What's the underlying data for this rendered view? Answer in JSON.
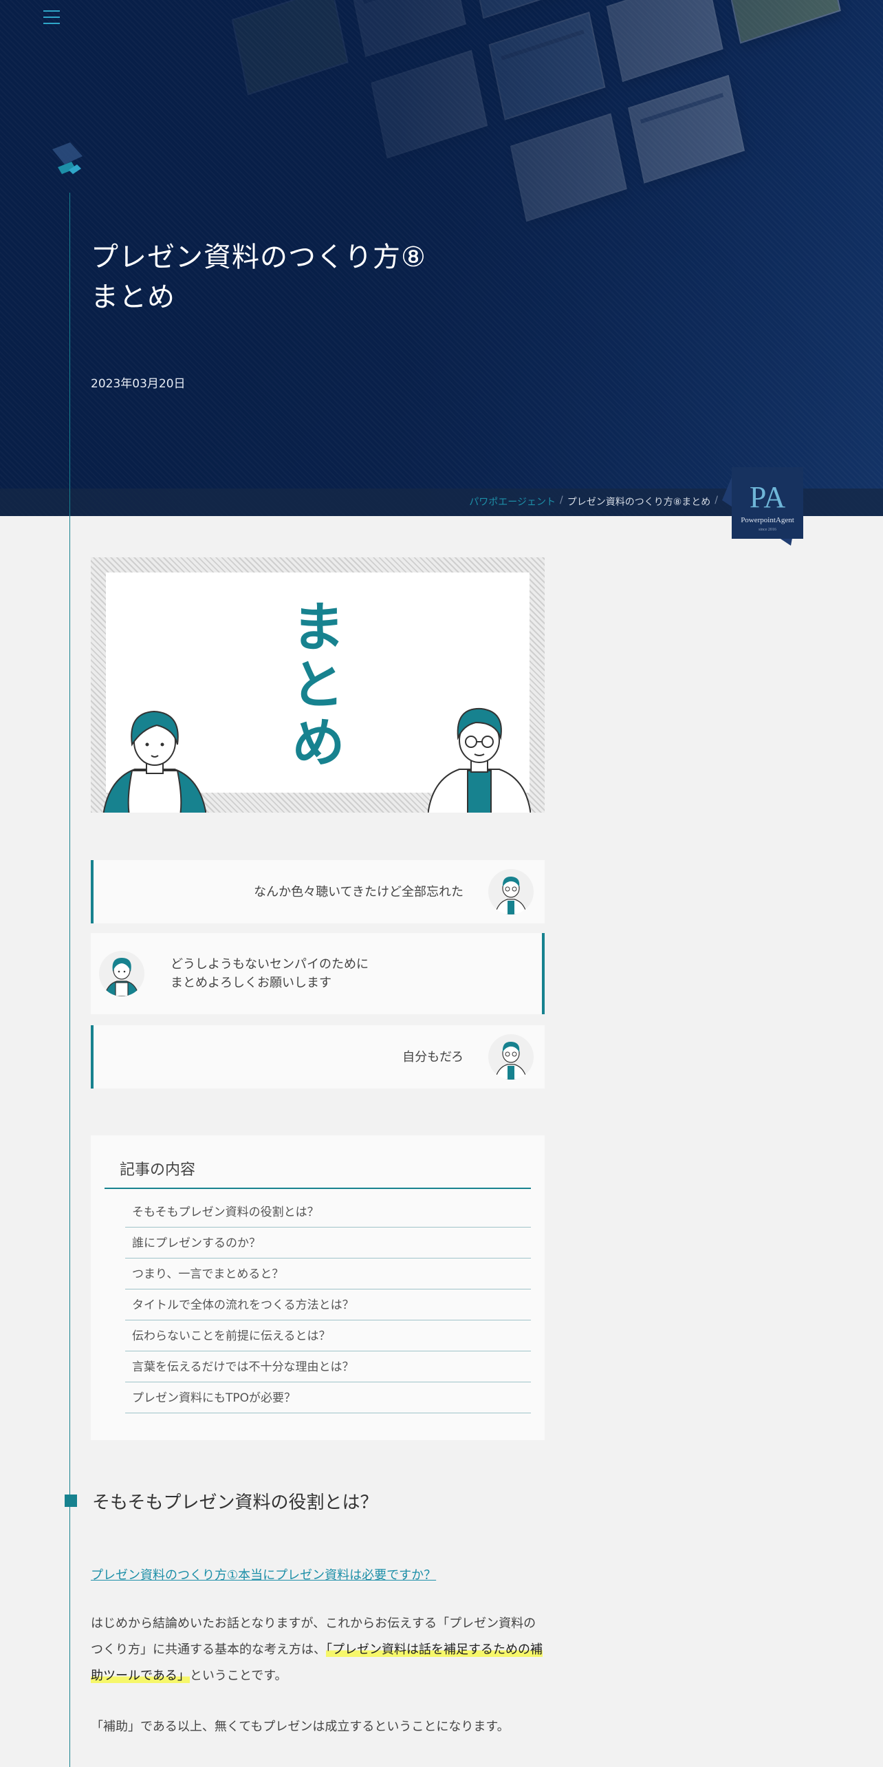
{
  "hero": {
    "title_line1": "プレゼン資料のつくり方⑧",
    "title_line2": "まとめ",
    "date": "2023年03月20日"
  },
  "breadcrumb": {
    "home": "パワポエージェント",
    "separator": "/",
    "current": "プレゼン資料のつくり方⑧まとめ"
  },
  "badge": {
    "logo_text": "PA",
    "name": "PowerpointAgent",
    "since": "since 2016"
  },
  "eyecatch": {
    "word": "まとめ"
  },
  "chat": [
    {
      "text": "なんか色々聴いてきたけど全部忘れた"
    },
    {
      "line1": "どうしようもないセンパイのために",
      "line2": "まとめよろしくお願いします"
    },
    {
      "text": "自分もだろ"
    }
  ],
  "toc": {
    "title": "記事の内容",
    "items": [
      "そもそもプレゼン資料の役割とは？",
      "誰にプレゼンするのか？",
      "つまり、一言でまとめると？",
      "タイトルで全体の流れをつくる方法とは？",
      "伝わらないことを前提に伝えるとは？",
      "言葉を伝えるだけでは不十分な理由とは？",
      "プレゼン資料にもTPOが必要？"
    ]
  },
  "section": {
    "heading": "そもそもプレゼン資料の役割とは？",
    "link": "プレゼン資料のつくり方①本当にプレゼン資料は必要ですか？",
    "p1_a": "はじめから結論めいたお話となりますが、これからお伝えする「プレゼン資料のつくり方」に共通する基本的な考え方は、",
    "p1_highlight": "「プレゼン資料は話を補足するための補助ツールである」",
    "p1_b": "ということです。",
    "p2": "「補助」である以上、無くてもプレゼンは成立するということになります。"
  },
  "colors": {
    "accent": "#17828f",
    "hero_bg": "#0b2756",
    "highlight": "#f6f76a"
  }
}
